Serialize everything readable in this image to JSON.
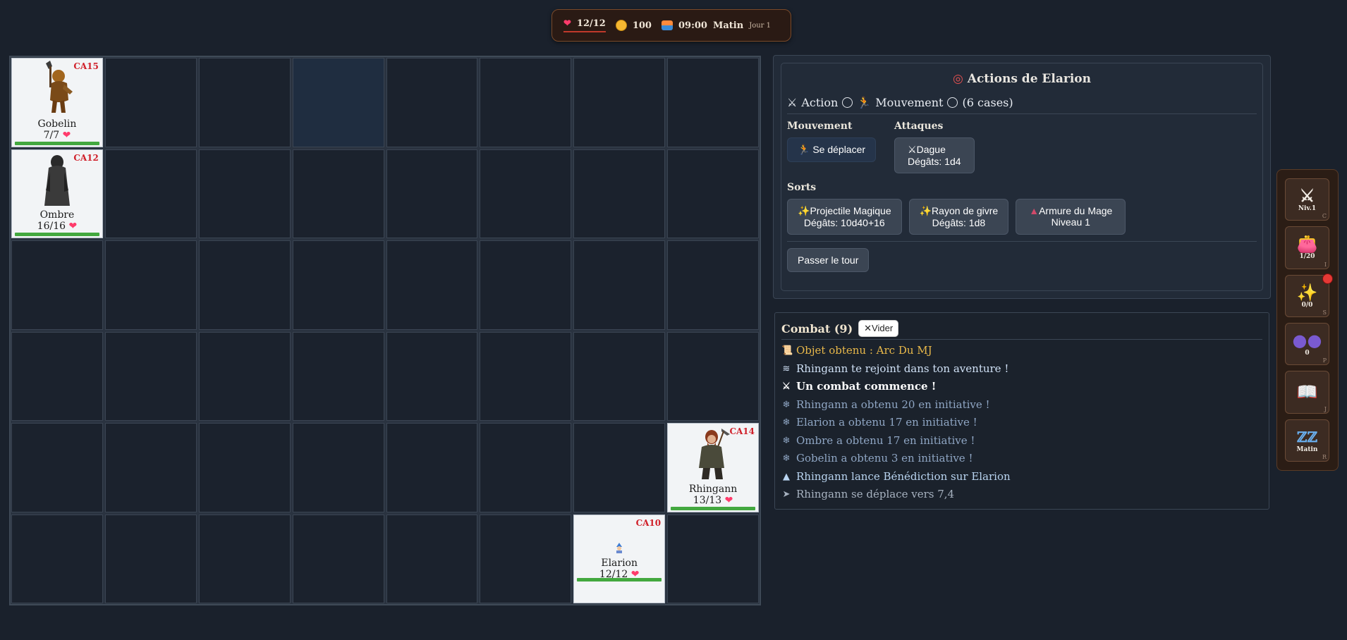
{
  "status": {
    "hp": "12/12",
    "gold": "100",
    "time": "09:00",
    "period": "Matin",
    "day": "Jour 1"
  },
  "tokens": {
    "gobelin": {
      "name": "Gobelin",
      "ca": "CA15",
      "hp": "7/7",
      "hp_fraction": 1.0
    },
    "ombre": {
      "name": "Ombre",
      "ca": "CA12",
      "hp": "16/16",
      "hp_fraction": 1.0
    },
    "rhingann": {
      "name": "Rhingann",
      "ca": "CA14",
      "hp": "13/13",
      "hp_fraction": 1.0
    },
    "elarion": {
      "name": "Elarion",
      "ca": "CA10",
      "hp": "12/12",
      "hp_fraction": 1.0
    }
  },
  "actions": {
    "title": "Actions de Elarion",
    "action_label": "Action",
    "move_label": "Mouvement",
    "move_extra": "(6 cases)",
    "movement_title": "Mouvement",
    "move_button": "Se déplacer",
    "attacks_title": "Attaques",
    "attack": {
      "name": "Dague",
      "damage": "Dégâts: 1d4"
    },
    "spells_title": "Sorts",
    "spells": [
      {
        "name": "Projectile Magique",
        "detail": "Dégâts: 10d40+16"
      },
      {
        "name": "Rayon de givre",
        "detail": "Dégâts: 1d8"
      },
      {
        "name": "Armure du Mage",
        "detail": "Niveau 1"
      }
    ],
    "pass_turn": "Passer le tour"
  },
  "log": {
    "title": "Combat",
    "count": "(9)",
    "clear": "Vider",
    "entries": [
      {
        "text": "Objet obtenu : Arc Du MJ",
        "color": "#e8b84a"
      },
      {
        "text": "Rhingann te rejoint dans ton aventure !",
        "color": "#cfe0f5"
      },
      {
        "text": "Un combat commence !",
        "color": "#ffffff"
      },
      {
        "text": "Rhingann a obtenu 20 en initiative !",
        "color": "#8fa6c4"
      },
      {
        "text": "Elarion a obtenu 17 en initiative !",
        "color": "#8fa6c4"
      },
      {
        "text": "Ombre a obtenu 17 en initiative !",
        "color": "#8fa6c4"
      },
      {
        "text": "Gobelin a obtenu 3 en initiative !",
        "color": "#8fa6c4"
      },
      {
        "text": "Rhingann lance Bénédiction sur Elarion",
        "color": "#b9d4f0"
      },
      {
        "text": "Rhingann se déplace vers 7,4",
        "color": "#a7b2c0"
      }
    ]
  },
  "toolbar": {
    "level": {
      "label": "Niv.1",
      "key": "C"
    },
    "inventory": {
      "label": "1/20",
      "key": "I"
    },
    "spells": {
      "label": "0/0",
      "key": "S"
    },
    "party": {
      "label": "0",
      "key": "P"
    },
    "journal": {
      "key": "J"
    },
    "rest": {
      "label": "Matin",
      "key": "R"
    }
  }
}
